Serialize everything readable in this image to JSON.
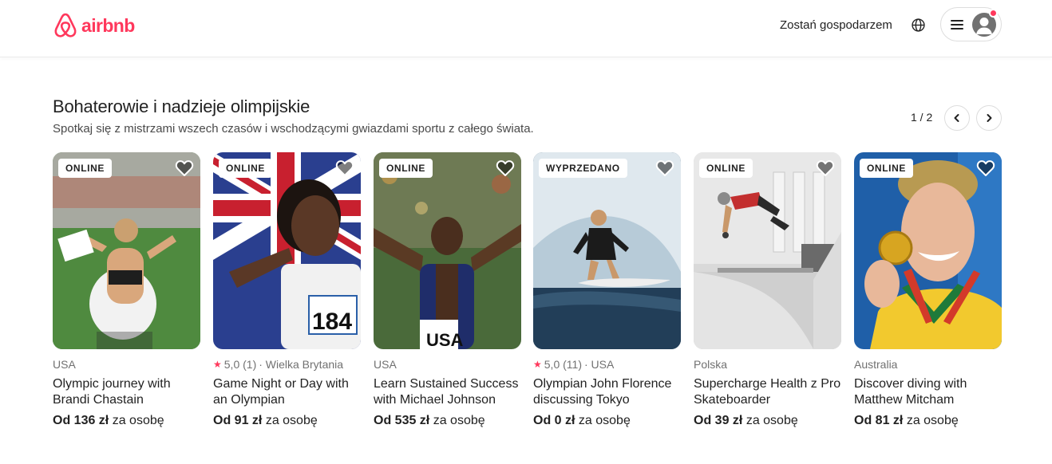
{
  "header": {
    "logo_text": "airbnb",
    "host_link": "Zostań gospodarzem",
    "icons": {
      "globe": "globe-icon",
      "menu": "hamburger-menu-icon",
      "avatar": "user-avatar-icon"
    },
    "brand_color": "#ff385c"
  },
  "section": {
    "title": "Bohaterowie i nadzieje olimpijskie",
    "subtitle": "Spotkaj się z mistrzami wszech czasów i wschodzącymi gwiazdami sportu z całego świata.",
    "pager": "1 / 2"
  },
  "cards": [
    {
      "badge": "ONLINE",
      "meta": "USA",
      "rating": "",
      "title": "Olympic journey with Brandi Chastain",
      "price": "Od 136 zł",
      "price_suffix": "za osobę"
    },
    {
      "badge": "ONLINE",
      "meta": "· Wielka Brytania",
      "rating": "5,0 (1)",
      "title": "Game Night or Day with an Olympian",
      "price": "Od 91 zł",
      "price_suffix": "za osobę"
    },
    {
      "badge": "ONLINE",
      "meta": "USA",
      "rating": "",
      "title": "Learn Sustained Success with Michael Johnson",
      "price": "Od 535 zł",
      "price_suffix": "za osobę"
    },
    {
      "badge": "WYPRZEDANO",
      "meta": "· USA",
      "rating": "5,0 (11)",
      "title": "Olympian John Florence discussing Tokyo",
      "price": "Od 0 zł",
      "price_suffix": "za osobę"
    },
    {
      "badge": "ONLINE",
      "meta": "Polska",
      "rating": "",
      "title": "Supercharge Health z Pro Skateboarder",
      "price": "Od 39 zł",
      "price_suffix": "za osobę"
    },
    {
      "badge": "ONLINE",
      "meta": "Australia",
      "rating": "",
      "title": "Discover diving with Matthew Mitcham",
      "price": "Od 81 zł",
      "price_suffix": "za osobę"
    }
  ]
}
